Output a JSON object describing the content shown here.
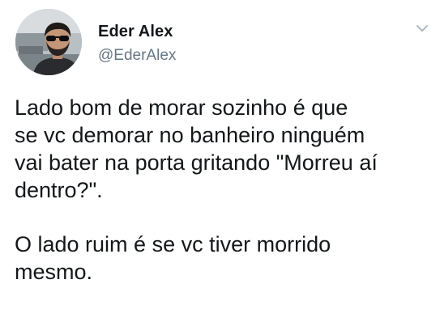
{
  "tweet": {
    "author": {
      "name": "Eder Alex",
      "handle": "@EderAlex",
      "avatar_icon": "avatar-photo-man-sunglasses"
    },
    "menu_icon": "chevron-down-icon",
    "paragraphs": [
      {
        "lines": [
          "Lado bom de morar sozinho é que",
          "se vc demorar no banheiro ninguém",
          "vai bater na porta gritando \"Morreu aí",
          "dentro?\"."
        ]
      },
      {
        "lines": [
          "O lado ruim é se vc tiver morrido",
          "mesmo."
        ]
      }
    ]
  },
  "colors": {
    "text": "#14171a",
    "secondary": "#657786",
    "chevron": "#aab8c2",
    "background": "#ffffff"
  }
}
